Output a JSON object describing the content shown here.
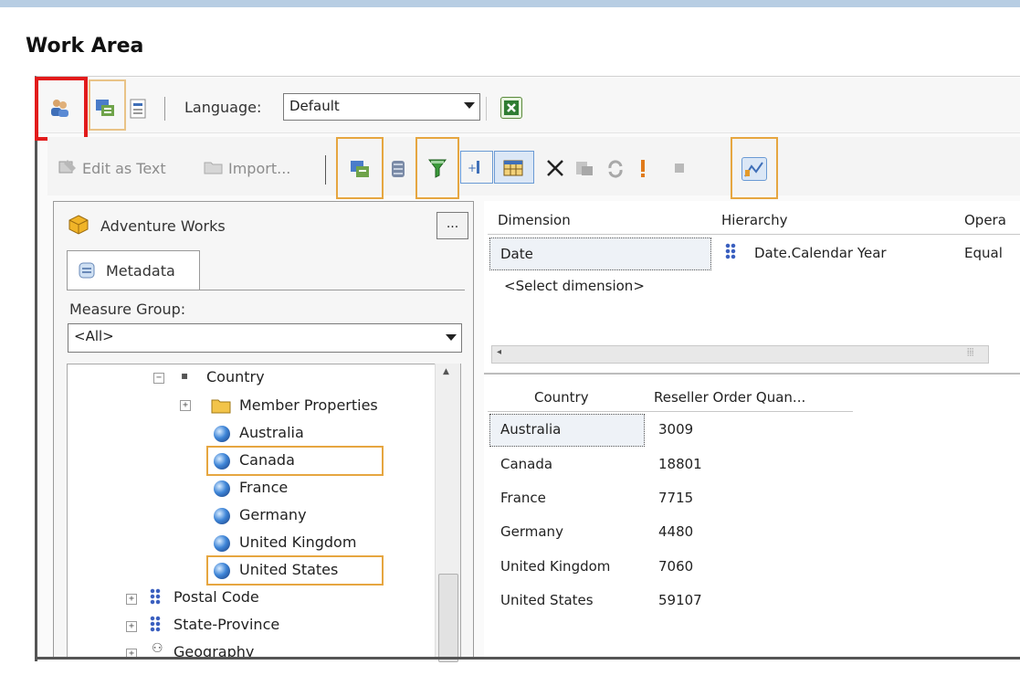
{
  "page": {
    "title": "Work Area"
  },
  "toolbar_top": {
    "language_label": "Language:",
    "language_value": "Default",
    "icons": [
      "user-group-icon",
      "design-mode-icon",
      "calculation-icon",
      "excel-icon"
    ]
  },
  "toolbar_second": {
    "edit_as_text": "Edit as Text",
    "import": "Import...",
    "icons": [
      "dimension-icon",
      "cube-icon",
      "filter-icon",
      "add-icon",
      "grid-icon",
      "delete-icon",
      "clipboard-icon",
      "refresh-icon",
      "exclamation-icon",
      "stop-icon",
      "chart-icon"
    ]
  },
  "left_panel": {
    "cube_name": "Adventure Works",
    "browse_button": "...",
    "tab_metadata": "Metadata",
    "measure_group_label": "Measure Group:",
    "measure_group_value": "<All>",
    "tree": {
      "country": "Country",
      "member_properties": "Member Properties",
      "members": [
        "Australia",
        "Canada",
        "France",
        "Germany",
        "United Kingdom",
        "United States"
      ],
      "postal_code": "Postal Code",
      "state_province": "State-Province",
      "geography": "Geography"
    }
  },
  "filter_pane": {
    "headers": [
      "Dimension",
      "Hierarchy",
      "Opera"
    ],
    "rows": [
      {
        "dimension": "Date",
        "hierarchy": "Date.Calendar Year",
        "operator": "Equal"
      }
    ],
    "select_prompt": "<Select dimension>"
  },
  "results": {
    "headers": [
      "Country",
      "Reseller Order Quan..."
    ],
    "rows": [
      {
        "country": "Australia",
        "value": "3009"
      },
      {
        "country": "Canada",
        "value": "18801"
      },
      {
        "country": "France",
        "value": "7715"
      },
      {
        "country": "Germany",
        "value": "4480"
      },
      {
        "country": "United Kingdom",
        "value": "7060"
      },
      {
        "country": "United States",
        "value": "59107"
      }
    ]
  },
  "colors": {
    "highlight_red": "#e21b1b",
    "highlight_orange": "#e6a640",
    "top_bar": "#b7cde3"
  }
}
